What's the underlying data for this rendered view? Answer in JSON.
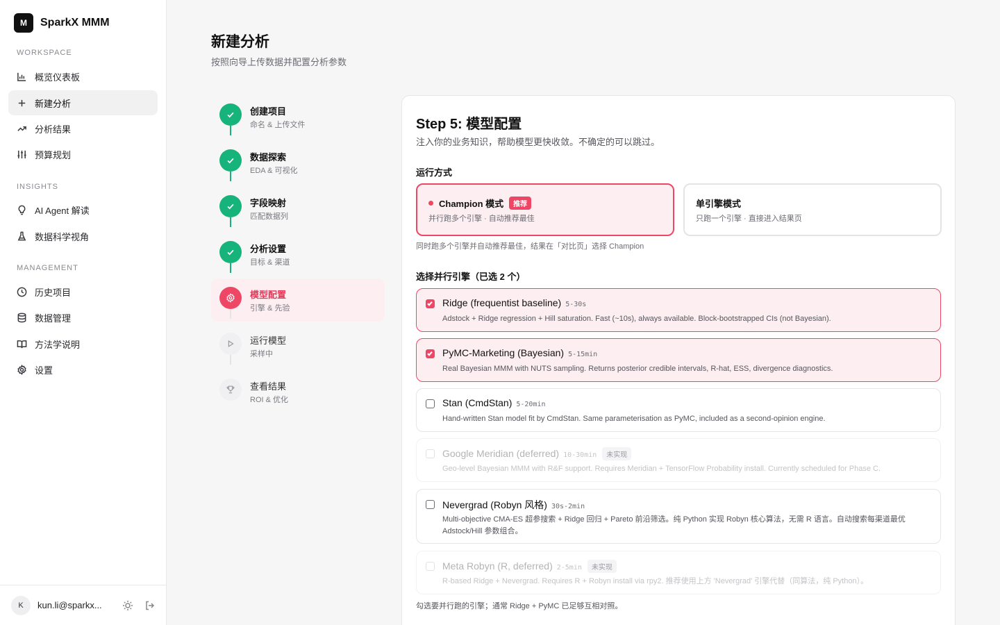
{
  "sidebar": {
    "brand_logo": "M",
    "brand_name": "SparkX MMM",
    "sections": {
      "workspace": "WORKSPACE",
      "insights": "INSIGHTS",
      "management": "MANAGEMENT"
    },
    "items": [
      {
        "label": "概览仪表板",
        "icon": "bar-chart-icon"
      },
      {
        "label": "新建分析",
        "icon": "plus-icon",
        "active": true
      },
      {
        "label": "分析结果",
        "icon": "trending-up-icon"
      },
      {
        "label": "预算规划",
        "icon": "sliders-icon"
      },
      {
        "label": "AI Agent 解读",
        "icon": "lightbulb-icon"
      },
      {
        "label": "数据科学视角",
        "icon": "flask-icon"
      },
      {
        "label": "历史项目",
        "icon": "clock-icon"
      },
      {
        "label": "数据管理",
        "icon": "database-icon"
      },
      {
        "label": "方法学说明",
        "icon": "book-icon"
      },
      {
        "label": "设置",
        "icon": "gear-icon"
      }
    ],
    "user": {
      "initial": "K",
      "email": "kun.li@sparkx..."
    }
  },
  "header": {
    "title": "新建分析",
    "subtitle": "按照向导上传数据并配置分析参数"
  },
  "steps": [
    {
      "title": "创建项目",
      "sub": "命名 & 上传文件",
      "status": "done"
    },
    {
      "title": "数据探索",
      "sub": "EDA & 可视化",
      "status": "done"
    },
    {
      "title": "字段映射",
      "sub": "匹配数据列",
      "status": "done"
    },
    {
      "title": "分析设置",
      "sub": "目标 & 渠道",
      "status": "done"
    },
    {
      "title": "模型配置",
      "sub": "引擎 & 先验",
      "status": "current"
    },
    {
      "title": "运行模型",
      "sub": "采样中",
      "status": "todo"
    },
    {
      "title": "查看结果",
      "sub": "ROI & 优化",
      "status": "todo"
    }
  ],
  "card": {
    "title": "Step 5: 模型配置",
    "desc": "注入你的业务知识，帮助模型更快收敛。不确定的可以跳过。",
    "run_mode_label": "运行方式",
    "modes": [
      {
        "title": "Champion 模式",
        "badge": "推荐",
        "sub": "并行跑多个引擎 · 自动推荐最佳",
        "selected": true
      },
      {
        "title": "单引擎模式",
        "sub": "只跑一个引擎 · 直接进入结果页",
        "selected": false
      }
    ],
    "mode_hint": "同时跑多个引擎并自动推荐最佳，结果在「对比页」选择 Champion",
    "engines_label": "选择并行引擎（已选 2 个）",
    "engines": [
      {
        "name": "Ridge (frequentist baseline)",
        "time": "5-30s",
        "desc": "Adstock + Ridge regression + Hill saturation. Fast (~10s), always available. Block-bootstrapped CIs (not Bayesian).",
        "checked": true,
        "disabled": false
      },
      {
        "name": "PyMC-Marketing (Bayesian)",
        "time": "5-15min",
        "desc": "Real Bayesian MMM with NUTS sampling. Returns posterior credible intervals, R-hat, ESS, divergence diagnostics.",
        "checked": true,
        "disabled": false
      },
      {
        "name": "Stan (CmdStan)",
        "time": "5-20min",
        "desc": "Hand-written Stan model fit by CmdStan. Same parameterisation as PyMC, included as a second-opinion engine.",
        "checked": false,
        "disabled": false
      },
      {
        "name": "Google Meridian (deferred)",
        "time": "10-30min",
        "tag": "未实现",
        "desc": "Geo-level Bayesian MMM with R&F support. Requires Meridian + TensorFlow Probability install. Currently scheduled for Phase C.",
        "checked": false,
        "disabled": true
      },
      {
        "name": "Nevergrad (Robyn 风格)",
        "time": "30s-2min",
        "desc": "Multi-objective CMA-ES 超参搜索 + Ridge 回归 + Pareto 前沿筛选。纯 Python 实现 Robyn 核心算法，无需 R 语言。自动搜索每渠道最优 Adstock/Hill 参数组合。",
        "checked": false,
        "disabled": false
      },
      {
        "name": "Meta Robyn (R, deferred)",
        "time": "2-5min",
        "tag": "未实现",
        "desc": "R-based Ridge + Nevergrad. Requires R + Robyn install via rpy2. 推荐使用上方 'Nevergrad' 引擎代替（同算法，纯 Python）。",
        "checked": false,
        "disabled": true
      }
    ],
    "engines_hint": "勾选要并行跑的引擎；通常 Ridge + PyMC 已足够互相对照。"
  },
  "colors": {
    "accent": "#ee4766",
    "accent_bg": "#fdeef1",
    "done": "#16b37a"
  }
}
